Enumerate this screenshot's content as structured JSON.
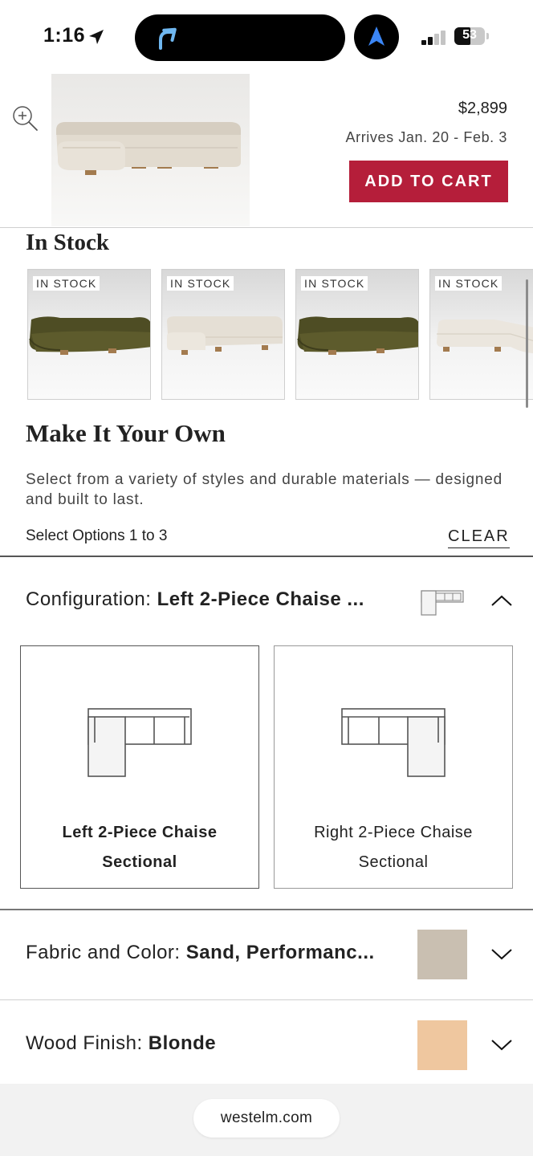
{
  "status_bar": {
    "time": "1:16",
    "battery": "53",
    "battery_level": 0.53
  },
  "product": {
    "price": "$2,899",
    "arrives": "Arrives Jan. 20 - Feb. 3",
    "add_to_cart": "ADD TO CART"
  },
  "in_stock": {
    "heading": "In Stock",
    "items": [
      {
        "badge": "IN STOCK",
        "color": "olive"
      },
      {
        "badge": "IN STOCK",
        "color": "sand"
      },
      {
        "badge": "IN STOCK",
        "color": "olive"
      },
      {
        "badge": "IN STOCK",
        "color": "sand"
      }
    ]
  },
  "make_it_your_own": {
    "heading": "Make It Your Own",
    "description": "Select from a variety of styles and durable materials — designed and built to last.",
    "select_options": "Select Options 1 to 3",
    "clear": "CLEAR"
  },
  "configuration": {
    "label": "Configuration:",
    "value": "Left 2-Piece Chaise ...",
    "options": [
      {
        "line1": "Left 2-Piece Chaise",
        "line2": "Sectional",
        "selected": true
      },
      {
        "line1": "Right 2-Piece Chaise",
        "line2": "Sectional",
        "selected": false
      }
    ]
  },
  "fabric": {
    "label": "Fabric and Color:",
    "value": "Sand, Performanc...",
    "swatch_color": "#c9bfb1"
  },
  "wood": {
    "label": "Wood Finish:",
    "value": "Blonde",
    "swatch_color": "#efc79f"
  },
  "browser": {
    "url": "westelm.com"
  },
  "colors": {
    "accent": "#b51e3a",
    "olive_velvet": "#4e4d24",
    "sand_boucle": "#e3ddd3"
  }
}
